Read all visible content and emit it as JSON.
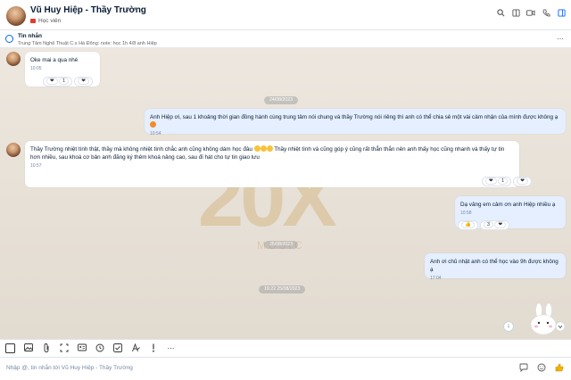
{
  "header": {
    "title": "Vũ Huy Hiệp - Thầy Trường",
    "subtitle": "Học viên",
    "icons": [
      "search-icon",
      "layout-icon",
      "video-icon",
      "phone-icon",
      "panel-icon"
    ]
  },
  "notice": {
    "title": "Tin nhắn",
    "text": "Trung Tâm Nghệ Thuật C.s Hà Đông: note: học 1h 4/8 anh Hiệp"
  },
  "messages": [
    {
      "text": "Oke mai a qua nhé",
      "time": "10:05",
      "reaction_count": "1"
    },
    {
      "date": "24/08/2023"
    },
    {
      "text": "Anh Hiệp ơi, sau 1 khoảng thời gian đồng hành cùng trung tâm nói chung và thầy Trường nói riêng thì anh có thể chia sẻ một vài cảm nhận của mình được không ạ",
      "time": "10:54"
    },
    {
      "text_line1a": "Thầy Trường nhiệt tình thật, thầy mà không nhiệt tình chắc anh cũng không dám học đâu",
      "text_line1b": "Thầy nhiệt tình và cũng góp ý cũng rất thẳn thắn nên anh thấy học cũng nhanh và thấy tự tin",
      "text_line2": "hơn nhiều, sau khoá cơ bản anh đăng ký thêm khoá nâng cao, sau đi hát cho tự tin giao lưu",
      "time": "10:57",
      "reaction_count": "1"
    },
    {
      "text": "Dạ vâng em cảm ơn anh Hiệp nhiều ạ",
      "time": "10:58",
      "reaction_count": "3"
    },
    {
      "date": "25/08/2023"
    },
    {
      "text": "Anh ơi chủ nhật anh có thể học vào 9h được không ạ",
      "time": "17:04"
    },
    {
      "date": "19:22 25/08/2023"
    }
  ],
  "watermark": {
    "main": "20X",
    "sub": "MUSIC"
  },
  "composer": {
    "placeholder": "Nhập @, tin nhắn tới Vũ Huy Hiệp - Thầy Trường"
  },
  "colors": {
    "accent": "#0068ff",
    "my_bubble": "#e5efff",
    "heart": "#e53935",
    "chat_bg": "#e9e3da"
  }
}
